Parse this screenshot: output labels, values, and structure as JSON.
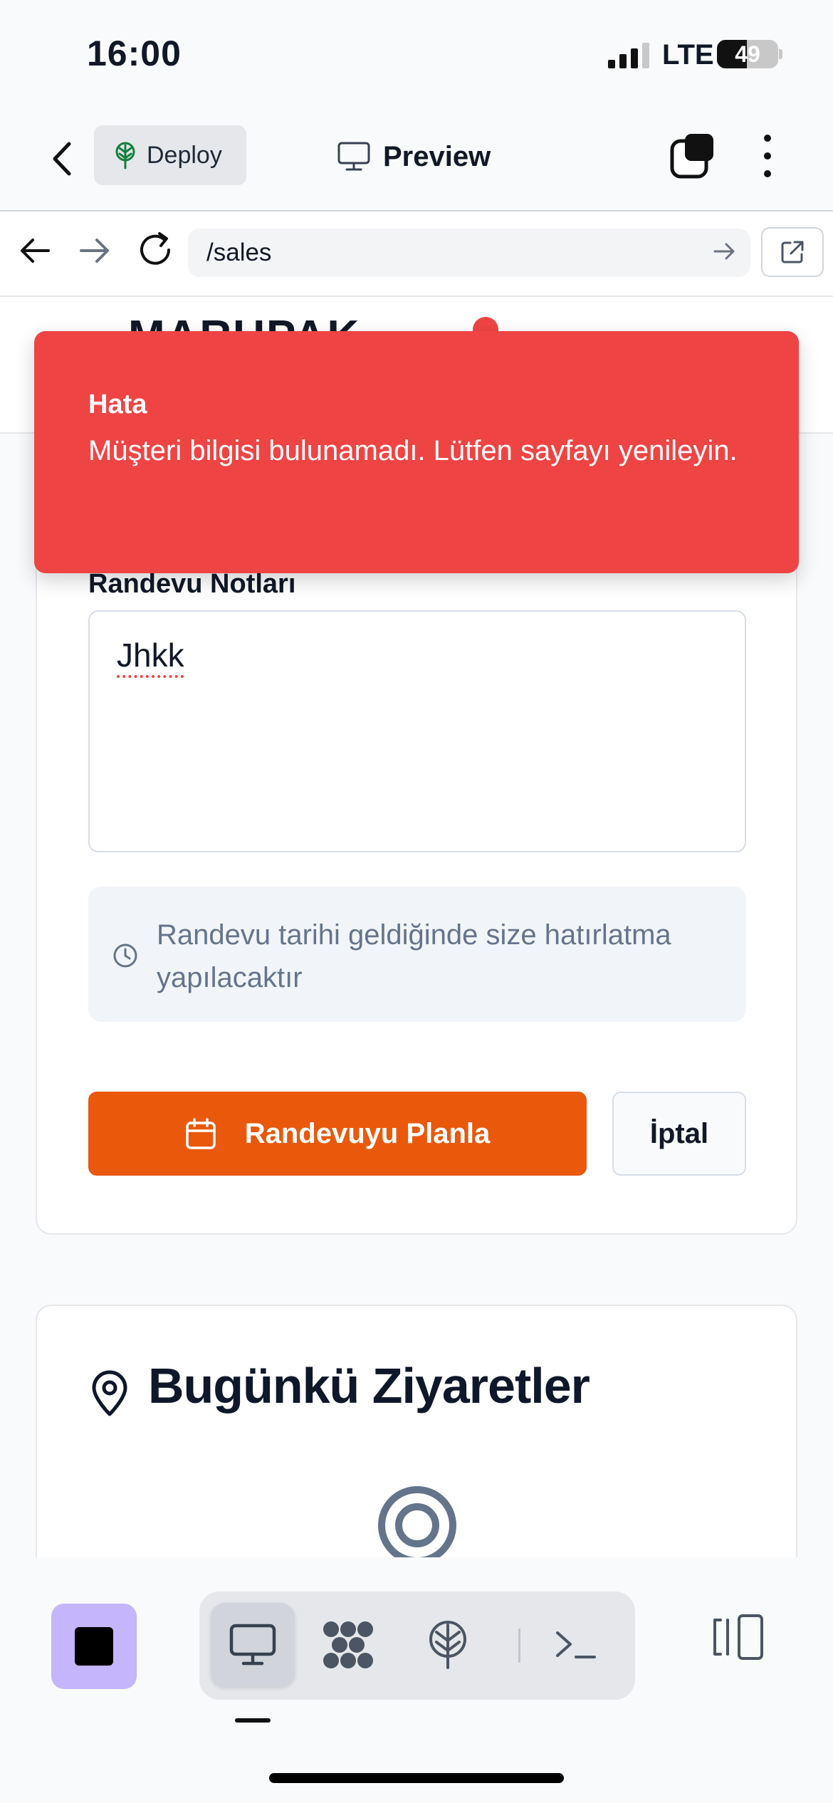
{
  "status_bar": {
    "time": "16:00",
    "network": "LTE",
    "battery": "49",
    "battery_level": 0.49
  },
  "toolbar": {
    "deploy_label": "Deploy",
    "preview_label": "Preview"
  },
  "browser": {
    "url": "/sales"
  },
  "page": {
    "brand": "MARUPAK",
    "form": {
      "notes_label": "Randevu Notları",
      "notes_value": "Jhkk",
      "reminder_text": "Randevu tarihi geldiğinde size hatırlatma yapılacaktır",
      "schedule_button": "Randevuyu Planla",
      "cancel_button": "İptal"
    },
    "visits": {
      "title": "Bugünkü Ziyaretler"
    }
  },
  "toast": {
    "title": "Hata",
    "message": "Müşteri bilgisi bulunamadı. Lütfen sayfayı yenileyin."
  },
  "colors": {
    "accent_orange": "#ea580c",
    "error_red": "#ef4444",
    "stop_button": "#c4b5fd"
  },
  "icons": {
    "back": "chevron-left-icon",
    "deploy": "deploy-tree-icon",
    "preview": "monitor-icon",
    "tabs": "tabs-icon",
    "more": "more-vertical-icon",
    "nav_back": "arrow-left-icon",
    "nav_forward": "arrow-right-icon",
    "reload": "reload-icon",
    "external": "external-link-icon",
    "reminder": "clock-icon",
    "schedule": "calendar-icon",
    "visits": "map-pin-icon",
    "empty_state": "target-icon",
    "dock": [
      "monitor-icon",
      "workflow-icon",
      "deploy-icon",
      "terminal-icon",
      "panel-toggle-icon"
    ]
  }
}
